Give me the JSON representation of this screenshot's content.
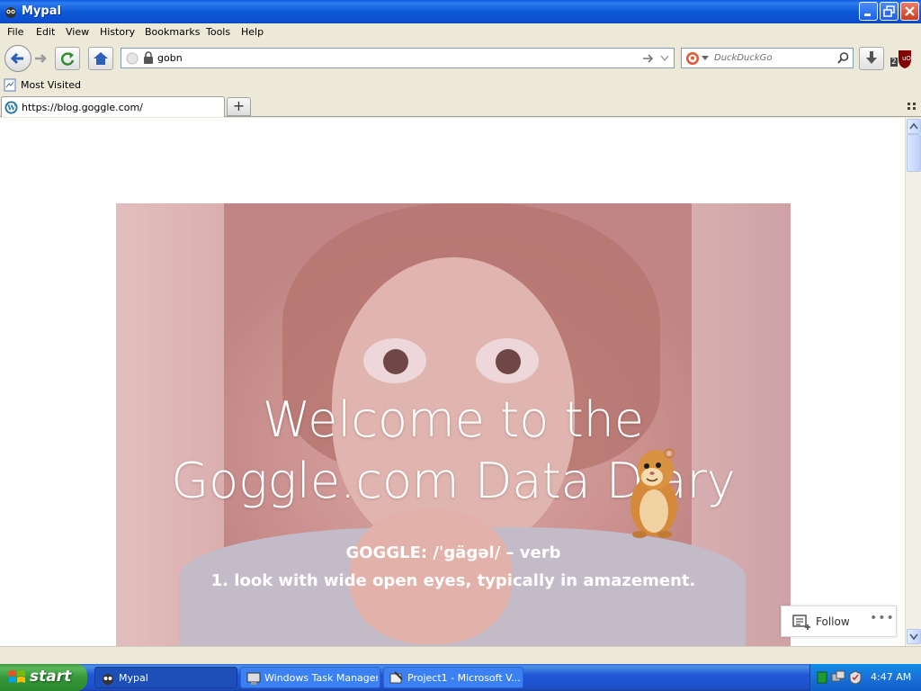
{
  "window": {
    "title": "Mypal"
  },
  "menu": {
    "items": [
      "File",
      "Edit",
      "View",
      "History",
      "Bookmarks",
      "Tools",
      "Help"
    ]
  },
  "toolbar": {
    "url": "gobn",
    "search_placeholder": "DuckDuckGo",
    "addon_badge": "2"
  },
  "bookmarks": {
    "most_visited": "Most Visited"
  },
  "tab": {
    "title": "https://blog.goggle.com/"
  },
  "page": {
    "title_line1": "Welcome to the",
    "title_line2": "Goggle.com Data Diary",
    "definition_1": "GOGGLE: /ˈgägəl/ – verb",
    "definition_2": "1. look with wide open eyes, typically in amazement.",
    "follow_label": "Follow",
    "more_label": "•••"
  },
  "taskbar": {
    "start_label": "start",
    "tasks": [
      "Mypal",
      "Windows Task Manager",
      "Project1 - Microsoft V..."
    ],
    "clock": "4:47 AM"
  }
}
